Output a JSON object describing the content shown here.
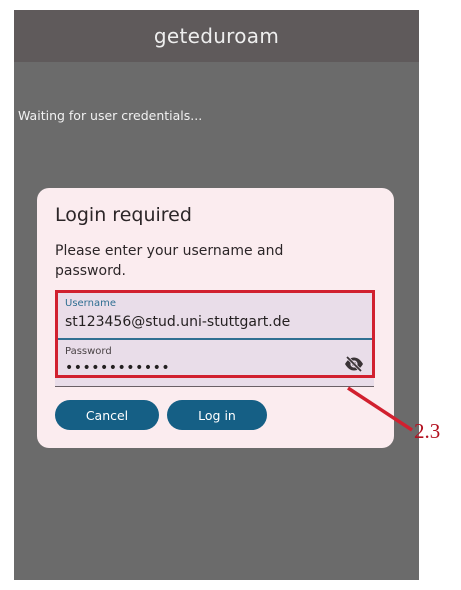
{
  "app": {
    "title": "geteduroam",
    "status": "Waiting for user credentials..."
  },
  "dialog": {
    "title": "Login required",
    "message": "Please enter your username and password.",
    "username": {
      "label": "Username",
      "value": "st123456@stud.uni-stuttgart.de"
    },
    "password": {
      "label": "Password",
      "value": "••••••••••••",
      "visibility_icon": "eye-off-icon"
    },
    "buttons": {
      "cancel": "Cancel",
      "login": "Log in"
    }
  },
  "annotation": {
    "label": "2.3"
  },
  "colors": {
    "accent": "#155f85",
    "annotation": "#d1202f",
    "dialog_bg": "#fbecef",
    "overlay": "#6b6b6b"
  }
}
